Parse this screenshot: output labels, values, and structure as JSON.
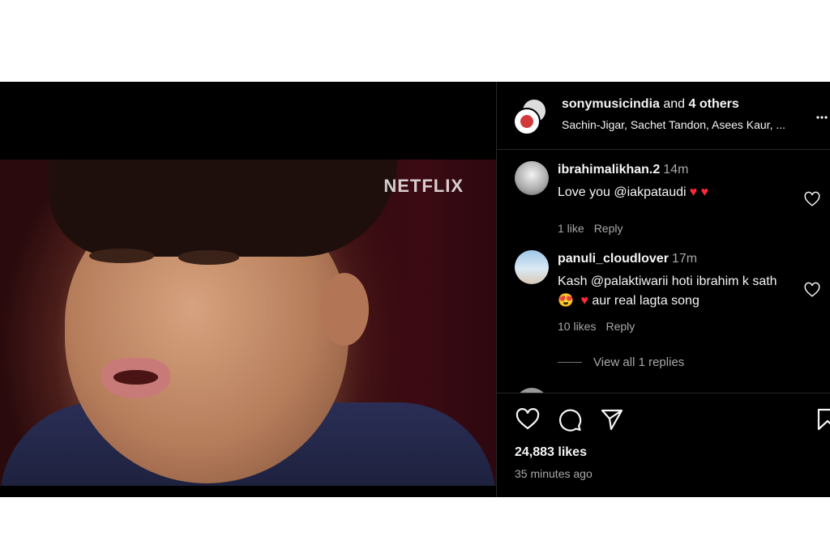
{
  "video": {
    "brand_watermark": "NETFLIX",
    "mute_icon": "speaker-icon"
  },
  "header": {
    "account": "sonymusicindia",
    "joiner": " and ",
    "others": "4 others",
    "collaborators": "Sachin-Jigar, Sachet Tandon, Asees Kaur, ...",
    "more_icon": "more-icon"
  },
  "comments": [
    {
      "username": "ibrahimalikhan.2",
      "time": "14m",
      "text": "Love you @iakpataudi",
      "emojis": "♥ ♥",
      "likes": "1 like",
      "reply": "Reply"
    },
    {
      "username": "panuli_cloudlover",
      "time": "17m",
      "text": "Kash @palaktiwarii hoti ibrahim k sath",
      "emoji_face": "😍",
      "emoji_heart": "♥",
      "text_end": " aur real lagta song",
      "likes": "10 likes",
      "reply": "Reply",
      "view_replies": "View all 1 replies"
    }
  ],
  "actions": {
    "like_icon": "heart-icon",
    "comment_icon": "comment-icon",
    "share_icon": "share-icon",
    "save_icon": "bookmark-icon"
  },
  "stats": {
    "likes": "24,883 likes",
    "time_ago": "35 minutes ago"
  },
  "colors": {
    "background": "#000000",
    "text": "#f5f5f5",
    "secondary_text": "#a8a8a8",
    "heart_red": "#ff2b3a"
  }
}
